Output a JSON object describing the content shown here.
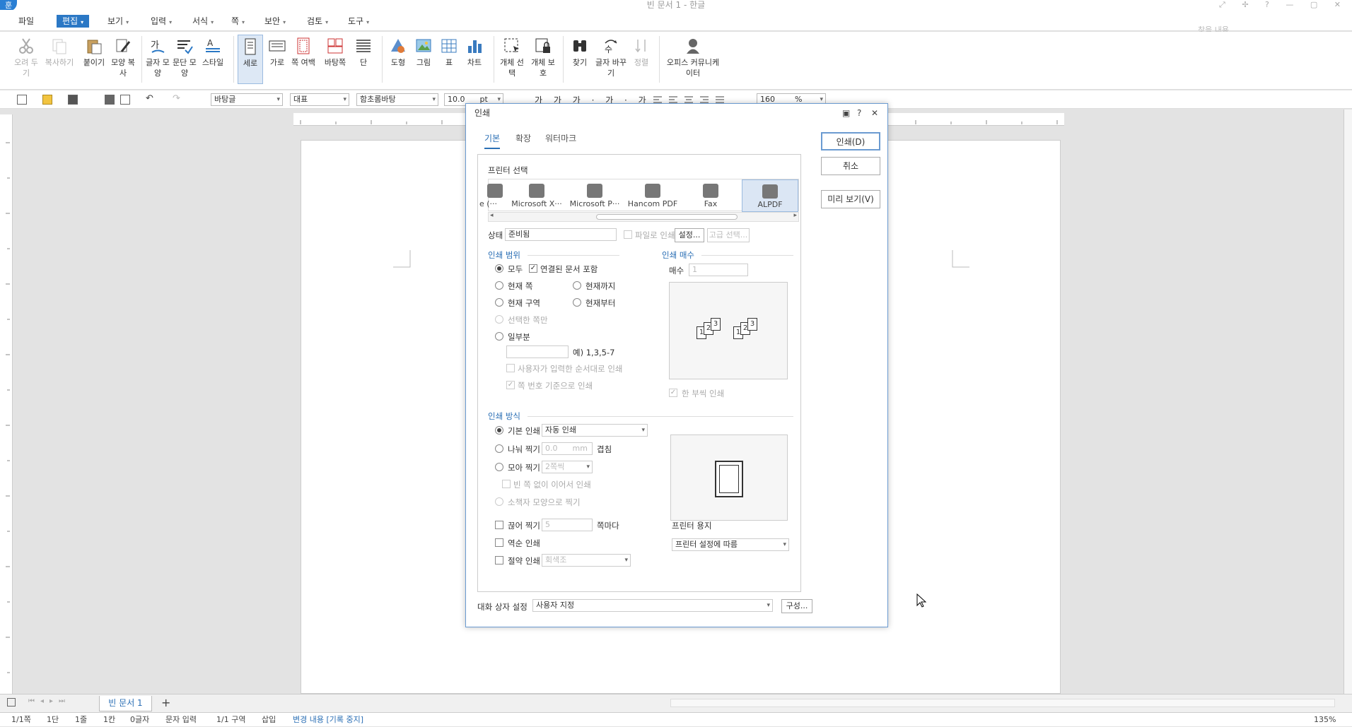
{
  "window": {
    "title": "빈 문서 1 - 한글",
    "logo": "훈",
    "controls": "⤢ ✢ ? — ▢ ✕"
  },
  "menu": {
    "items": [
      "파일",
      "편집",
      "보기",
      "입력",
      "서식",
      "쪽",
      "보안",
      "검토",
      "도구"
    ],
    "search_placeholder": "찾을 내용"
  },
  "ribbon": {
    "buttons": [
      "오려 두기",
      "복사하기",
      "붙이기",
      "모양 복사",
      "글자 모양",
      "문단 모양",
      "스타일",
      "세로",
      "가로",
      "쪽 여백",
      "바탕쪽",
      "단",
      "도형",
      "그림",
      "표",
      "차트",
      "개체 선택",
      "개체 보호",
      "찾기",
      "글자 바꾸기",
      "정렬",
      "오피스 커뮤니케이터"
    ]
  },
  "toolbar": {
    "style": "바탕글",
    "para": "대표",
    "font": "함초롬바탕",
    "size": "10.0",
    "unit": "pt",
    "zoom": "160",
    "zoom_unit": "%"
  },
  "dialog": {
    "title": "인쇄",
    "help": "?",
    "close": "✕",
    "tabs": [
      "기본",
      "확장",
      "워터마크"
    ],
    "printer_section": "프린터 선택",
    "printers": [
      "e (···",
      "Microsoft X···",
      "Microsoft P···",
      "Hancom PDF",
      "Fax",
      "ALPDF"
    ],
    "status_label": "상태",
    "status_value": "준비됨",
    "print_to_file": "파일로 인쇄",
    "settings_btn": "설정...",
    "advanced_btn": "고급 선택...",
    "range_title": "인쇄 범위",
    "range_all": "모두",
    "range_linked": "연결된 문서 포함",
    "range_current_page": "현재 쪽",
    "range_until_current": "현재까지",
    "range_current_section": "현재 구역",
    "range_from_current": "현재부터",
    "range_selected": "선택한 쪽만",
    "range_partial": "일부분",
    "range_example": "예) 1,3,5-7",
    "range_user_order": "사용자가 입력한 순서대로 인쇄",
    "range_page_number": "쪽 번호 기준으로 인쇄",
    "copies_title": "인쇄 매수",
    "copies_label": "매수",
    "copies_value": "1",
    "collate": "한 부씩 인쇄",
    "method_title": "인쇄 방식",
    "method_basic": "기본 인쇄",
    "method_basic_value": "자동 인쇄",
    "method_split": "나눠 찍기",
    "method_split_value": "0.0",
    "method_split_unit": "mm",
    "method_overlap": "겹침",
    "method_gather": "모아 찍기",
    "method_gather_value": "2쪽씩",
    "method_no_blank": "빈 쪽 없이 이어서 인쇄",
    "method_booklet": "소책자 모양으로 찍기",
    "method_cut": "끊어 찍기",
    "method_cut_value": "5",
    "method_cut_unit": "쪽마다",
    "method_reverse": "역순 인쇄",
    "method_save": "절약 인쇄",
    "method_save_value": "회색조",
    "paper_label": "프린터 용지",
    "paper_value": "프린터 설정에 따름",
    "dialog_settings_label": "대화 상자 설정",
    "dialog_settings_value": "사용자 지정",
    "config_btn": "구성...",
    "print_btn": "인쇄(D)",
    "cancel_btn": "취소",
    "preview_btn": "미리 보기(V)"
  },
  "tabs": {
    "doc": "빈 문서 1",
    "add": "+"
  },
  "status": [
    "1/1쪽",
    "1단",
    "1줄",
    "1칸",
    "0글자",
    "문자 입력",
    "1/1 구역",
    "삽입",
    "변경 내용 [기록 중지]",
    "135%"
  ]
}
